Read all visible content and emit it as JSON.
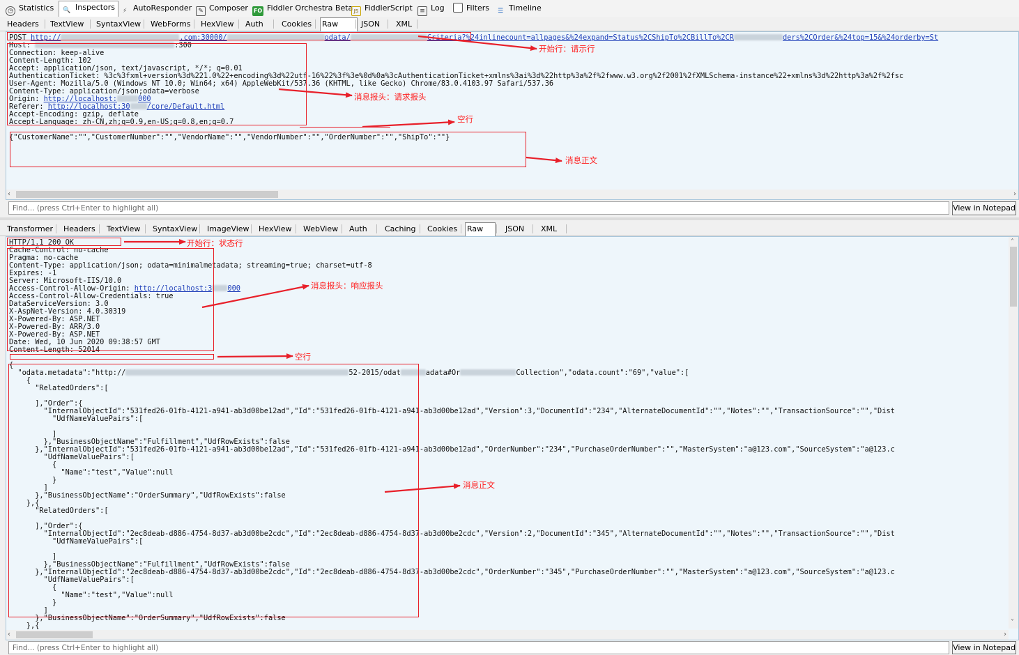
{
  "toolbar": {
    "items": [
      {
        "label": "Statistics",
        "icon": "statistics-icon"
      },
      {
        "label": "Inspectors",
        "icon": "inspectors-icon"
      },
      {
        "label": "AutoResponder",
        "icon": "lightning-icon"
      },
      {
        "label": "Composer",
        "icon": "composer-icon"
      },
      {
        "label": "Fiddler Orchestra Beta",
        "icon": "fo-icon"
      },
      {
        "label": "FiddlerScript",
        "icon": "script-icon"
      },
      {
        "label": "Log",
        "icon": "log-icon"
      },
      {
        "label": "Filters",
        "icon": "checkbox-icon"
      },
      {
        "label": "Timeline",
        "icon": "timeline-icon"
      }
    ],
    "fo_badge": "FO",
    "js_badge": "JS"
  },
  "request_tabs": [
    "Headers",
    "TextView",
    "SyntaxView",
    "WebForms",
    "HexView",
    "Auth",
    "Cookies",
    "Raw",
    "JSON",
    "XML"
  ],
  "response_tabs": [
    "Transformer",
    "Headers",
    "TextView",
    "SyntaxView",
    "ImageView",
    "HexView",
    "WebView",
    "Auth",
    "Caching",
    "Cookies",
    "Raw",
    "JSON",
    "XML"
  ],
  "request": {
    "line1_method": "POST ",
    "line1_url_a": "http://",
    "line1_url_b": ".com:30000/",
    "line1_url_c": "odata/",
    "line1_url_d": "Criteria?%24inlinecount=allpages&%24expand=Status%2CShipTo%2CBillTo%2CR",
    "line1_url_e": "ders%2COrder&%24top=15&%24orderby=St",
    "host_label": "Host: ",
    "host_tail": ":300",
    "headers": [
      "Connection: keep-alive",
      "Content-Length: 102",
      "Accept: application/json, text/javascript, */*; q=0.01",
      "AuthenticationTicket: %3c%3fxml+version%3d%221.0%22+encoding%3d%22utf-16%22%3f%3e%0d%0a%3cAuthenticationTicket+xmlns%3ai%3d%22http%3a%2f%2fwww.w3.org%2f2001%2fXMLSchema-instance%22+xmlns%3d%22http%3a%2f%2fsc",
      "User-Agent: Mozilla/5.0 (Windows NT 10.0; Win64; x64) AppleWebKit/537.36 (KHTML, like Gecko) Chrome/83.0.4103.97 Safari/537.36",
      "Content-Type: application/json;odata=verbose"
    ],
    "origin_label": "Origin: ",
    "origin_link": "http://localhost:",
    "origin_link_tail": "000",
    "referer_label": "Referer: ",
    "referer_link": "http://localhost:30",
    "referer_link_tail": "/core/Default.html",
    "tail_headers": [
      "Accept-Encoding: gzip, deflate",
      "Accept-Language: zh-CN,zh;q=0.9,en-US;q=0.8,en;q=0.7"
    ],
    "body": "{\"CustomerName\":\"\",\"CustomerNumber\":\"\",\"VendorName\":\"\",\"VendorNumber\":\"\",\"OrderNumber\":\"\",\"ShipTo\":\"\"}",
    "find_placeholder": "Find... (press Ctrl+Enter to highlight all)",
    "notepad_label": "View in Notepad"
  },
  "response": {
    "status_line": "HTTP/1.1 200 OK",
    "headers": [
      "Cache-Control: no-cache",
      "Pragma: no-cache",
      "Content-Type: application/json; odata=minimalmetadata; streaming=true; charset=utf-8",
      "Expires: -1",
      "Server: Microsoft-IIS/10.0"
    ],
    "acao_label": "Access-Control-Allow-Origin: ",
    "acao_link": "http://localhost:3",
    "acao_link_tail": "000",
    "headers2": [
      "Access-Control-Allow-Credentials: true",
      "DataServiceVersion: 3.0",
      "X-AspNet-Version: 4.0.30319",
      "X-Powered-By: ASP.NET",
      "X-Powered-By: ARR/3.0",
      "X-Powered-By: ASP.NET",
      "Date: Wed, 10 Jun 2020 09:38:57 GMT",
      "Content-Length: 52014"
    ],
    "body_lines": [
      "{",
      "  \"odata.metadata\":\"http://",
      "    {",
      "      \"RelatedOrders\":[",
      "",
      "      ],\"Order\":{",
      "        \"InternalObjectId\":\"531fed26-01fb-4121-a941-ab3d00be12ad\",\"Id\":\"531fed26-01fb-4121-a941-ab3d00be12ad\",\"Version\":3,\"DocumentId\":\"234\",\"AlternateDocumentId\":\"\",\"Notes\":\"\",\"TransactionSource\":\"\",\"Dist",
      "          \"UdfNameValuePairs\":[",
      "",
      "          ]",
      "        },\"BusinessObjectName\":\"Fulfillment\",\"UdfRowExists\":false",
      "      },\"InternalObjectId\":\"531fed26-01fb-4121-a941-ab3d00be12ad\",\"Id\":\"531fed26-01fb-4121-a941-ab3d00be12ad\",\"OrderNumber\":\"234\",\"PurchaseOrderNumber\":\"\",\"MasterSystem\":\"a@123.com\",\"SourceSystem\":\"a@123.c",
      "        \"UdfNameValuePairs\":[",
      "          {",
      "            \"Name\":\"test\",\"Value\":null",
      "          }",
      "        ]",
      "      },\"BusinessObjectName\":\"OrderSummary\",\"UdfRowExists\":false",
      "    },{",
      "      \"RelatedOrders\":[",
      "",
      "      ],\"Order\":{",
      "        \"InternalObjectId\":\"2ec8deab-d886-4754-8d37-ab3d00be2cdc\",\"Id\":\"2ec8deab-d886-4754-8d37-ab3d00be2cdc\",\"Version\":2,\"DocumentId\":\"345\",\"AlternateDocumentId\":\"\",\"Notes\":\"\",\"TransactionSource\":\"\",\"Dist",
      "          \"UdfNameValuePairs\":[",
      "",
      "          ]",
      "        },\"BusinessObjectName\":\"Fulfillment\",\"UdfRowExists\":false",
      "      },\"InternalObjectId\":\"2ec8deab-d886-4754-8d37-ab3d00be2cdc\",\"Id\":\"2ec8deab-d886-4754-8d37-ab3d00be2cdc\",\"OrderNumber\":\"345\",\"PurchaseOrderNumber\":\"\",\"MasterSystem\":\"a@123.com\",\"SourceSystem\":\"a@123.c",
      "        \"UdfNameValuePairs\":[",
      "          {",
      "            \"Name\":\"test\",\"Value\":null",
      "          }",
      "        ]",
      "      },\"BusinessObjectName\":\"OrderSummary\",\"UdfRowExists\":false",
      "    },{"
    ],
    "metadata_tail_a": "52-2015/odat",
    "metadata_tail_b": "adata#Or",
    "metadata_tail_c": "Collection\",\"odata.count\":\"69\",\"value\":[",
    "find_placeholder": "Find... (press Ctrl+Enter to highlight all)",
    "notepad_label": "View in Notepad"
  },
  "annotations": {
    "req_start_line": "开始行：请示行",
    "req_headers": "消息报头：请求报头",
    "req_blank": "空行",
    "req_body": "消息正文",
    "resp_start_line": "开始行：状态行",
    "resp_headers": "消息报头：响应报头",
    "resp_blank": "空行",
    "resp_body": "消息正文"
  },
  "colors": {
    "annotation": "#ff1a1a",
    "pane_bg": "#eef6fb",
    "link": "#1f3fb9"
  }
}
